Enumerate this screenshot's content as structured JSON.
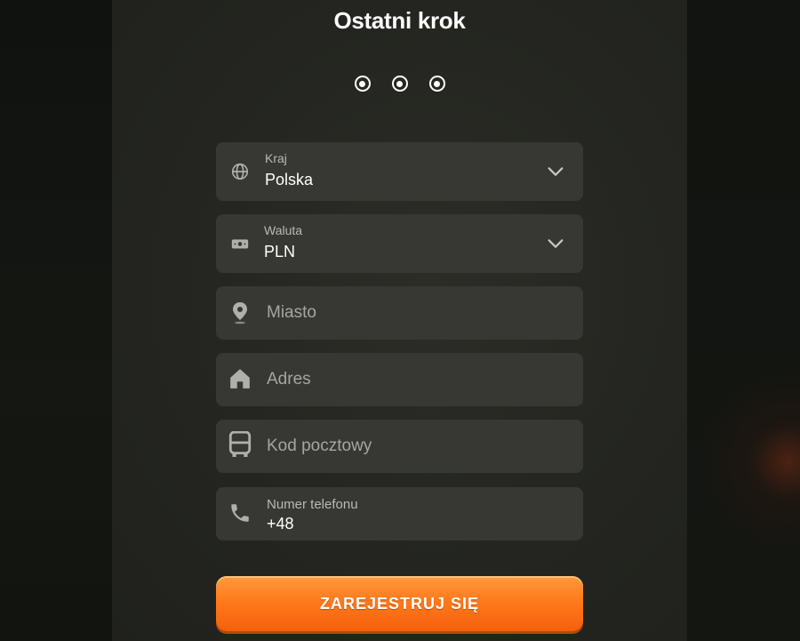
{
  "title": "Ostatni krok",
  "steps": [
    {
      "active": true
    },
    {
      "active": true
    },
    {
      "active": true
    }
  ],
  "form": {
    "country": {
      "label": "Kraj",
      "value": "Polska",
      "icon": "globe-icon"
    },
    "currency": {
      "label": "Waluta",
      "value": "PLN",
      "icon": "banknote-icon"
    },
    "city": {
      "placeholder": "Miasto",
      "icon": "map-pin-icon"
    },
    "address": {
      "placeholder": "Adres",
      "icon": "home-icon"
    },
    "postal_code": {
      "placeholder": "Kod pocztowy",
      "icon": "mailbox-icon"
    },
    "phone": {
      "label": "Numer telefonu",
      "value": "+48",
      "icon": "phone-icon"
    }
  },
  "submit_label": "ZAREJESTRUJ SIĘ",
  "colors": {
    "accent": "#ff7a1c",
    "field_bg": "#373733",
    "modal_bg": "#262721"
  }
}
